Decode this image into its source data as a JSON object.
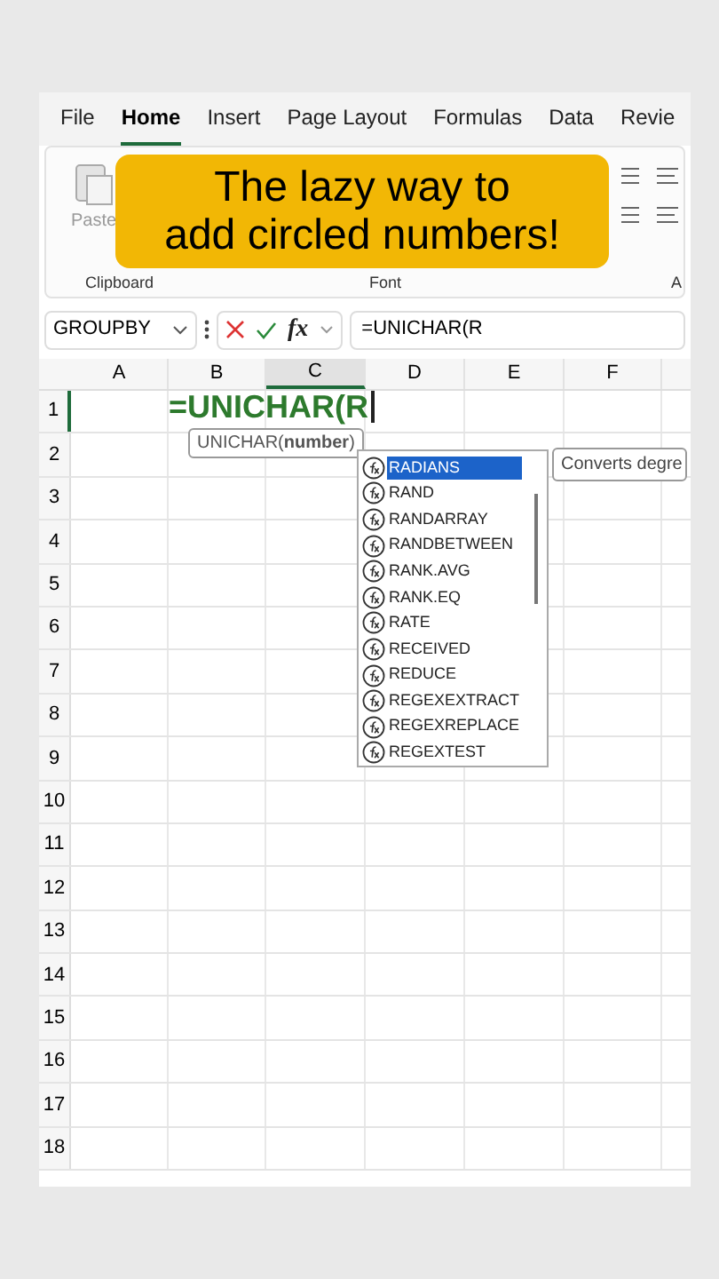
{
  "menu_tabs": [
    {
      "label": "File",
      "selected": false
    },
    {
      "label": "Home",
      "selected": true
    },
    {
      "label": "Insert",
      "selected": false
    },
    {
      "label": "Page Layout",
      "selected": false
    },
    {
      "label": "Formulas",
      "selected": false
    },
    {
      "label": "Data",
      "selected": false
    },
    {
      "label": "Revie",
      "selected": false
    }
  ],
  "ribbon": {
    "paste_label": "Paste",
    "groups": [
      "Clipboard",
      "Font",
      "A"
    ]
  },
  "caption": [
    "The lazy way to",
    "add circled numbers!"
  ],
  "formula_bar": {
    "name_box": "GROUPBY",
    "fx_label": "fx",
    "formula": "=UNICHAR(R"
  },
  "columns": [
    {
      "label": "A",
      "selected": false
    },
    {
      "label": "B",
      "selected": false
    },
    {
      "label": "C",
      "selected": true
    },
    {
      "label": "D",
      "selected": false
    },
    {
      "label": "E",
      "selected": false
    },
    {
      "label": "F",
      "selected": false
    }
  ],
  "rows": [
    {
      "label": "1",
      "selected": true
    },
    {
      "label": "2",
      "selected": false
    },
    {
      "label": "3",
      "selected": false
    },
    {
      "label": "4",
      "selected": false
    },
    {
      "label": "5",
      "selected": false
    },
    {
      "label": "6",
      "selected": false
    },
    {
      "label": "7",
      "selected": false
    },
    {
      "label": "8",
      "selected": false
    },
    {
      "label": "9",
      "selected": false
    },
    {
      "label": "10",
      "selected": false
    },
    {
      "label": "11",
      "selected": false
    },
    {
      "label": "12",
      "selected": false
    },
    {
      "label": "13",
      "selected": false
    },
    {
      "label": "14",
      "selected": false
    },
    {
      "label": "15",
      "selected": false
    },
    {
      "label": "16",
      "selected": false
    },
    {
      "label": "17",
      "selected": false
    },
    {
      "label": "18",
      "selected": false
    }
  ],
  "cell_entry": "=UNICHAR(R",
  "syntax_tooltip": "UNICHAR(**number**)",
  "autocomplete": [
    {
      "label": "RADIANS",
      "selected": true
    },
    {
      "label": "RAND",
      "selected": false
    },
    {
      "label": "RANDARRAY",
      "selected": false
    },
    {
      "label": "RANDBETWEEN",
      "selected": false
    },
    {
      "label": "RANK.AVG",
      "selected": false
    },
    {
      "label": "RANK.EQ",
      "selected": false
    },
    {
      "label": "RATE",
      "selected": false
    },
    {
      "label": "RECEIVED",
      "selected": false
    },
    {
      "label": "REDUCE",
      "selected": false
    },
    {
      "label": "REGEXEXTRACT",
      "selected": false
    },
    {
      "label": "REGEXREPLACE",
      "selected": false
    },
    {
      "label": "REGEXTEST",
      "selected": false
    }
  ],
  "description_tooltip": "Converts degre"
}
